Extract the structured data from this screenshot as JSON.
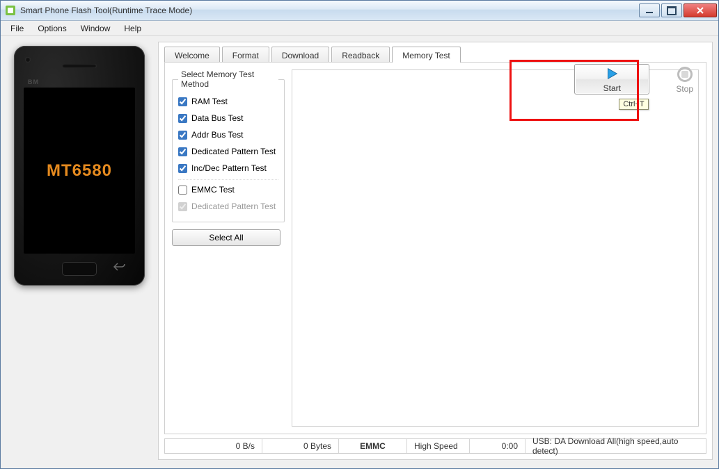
{
  "title": "Smart Phone Flash Tool(Runtime Trace Mode)",
  "menu": {
    "file": "File",
    "options": "Options",
    "window": "Window",
    "help": "Help"
  },
  "phone": {
    "brand": "BM",
    "screen_text": "MT6580"
  },
  "tabs": {
    "welcome": "Welcome",
    "format": "Format",
    "download": "Download",
    "readback": "Readback",
    "memory_test": "Memory Test"
  },
  "memory_test": {
    "group_title": "Select Memory Test Method",
    "ram_test": "RAM Test",
    "data_bus_test": "Data Bus Test",
    "addr_bus_test": "Addr Bus Test",
    "dedicated_pattern_test": "Dedicated Pattern Test",
    "inc_dec_pattern_test": "Inc/Dec Pattern Test",
    "emmc_test": "EMMC Test",
    "emmc_dedicated_pattern_test": "Dedicated Pattern Test",
    "select_all": "Select All"
  },
  "actions": {
    "start": "Start",
    "stop": "Stop",
    "tooltip": "Ctrl+T"
  },
  "status": {
    "speed": "0 B/s",
    "bytes": "0 Bytes",
    "storage": "EMMC",
    "mode": "High Speed",
    "time": "0:00",
    "usb": "USB: DA Download All(high speed,auto detect)"
  }
}
